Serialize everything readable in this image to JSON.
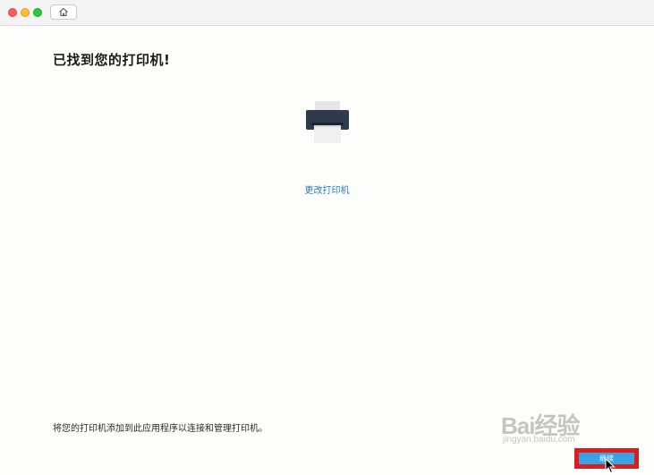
{
  "window": {
    "home_icon": "home-icon"
  },
  "main": {
    "title": "已找到您的打印机!",
    "printer_icon": "printer-icon",
    "change_printer_label": "更改打印机",
    "footer_text": "将您的打印机添加到此应用程序以连接和管理打印机。",
    "continue_label": "继续"
  },
  "watermark": {
    "brand": "Bai经验",
    "site": "jingyan.baidu.com"
  },
  "colors": {
    "link": "#2b7bbf",
    "continue_button": "#3aa3e4",
    "highlight_box": "#e01b1b"
  }
}
